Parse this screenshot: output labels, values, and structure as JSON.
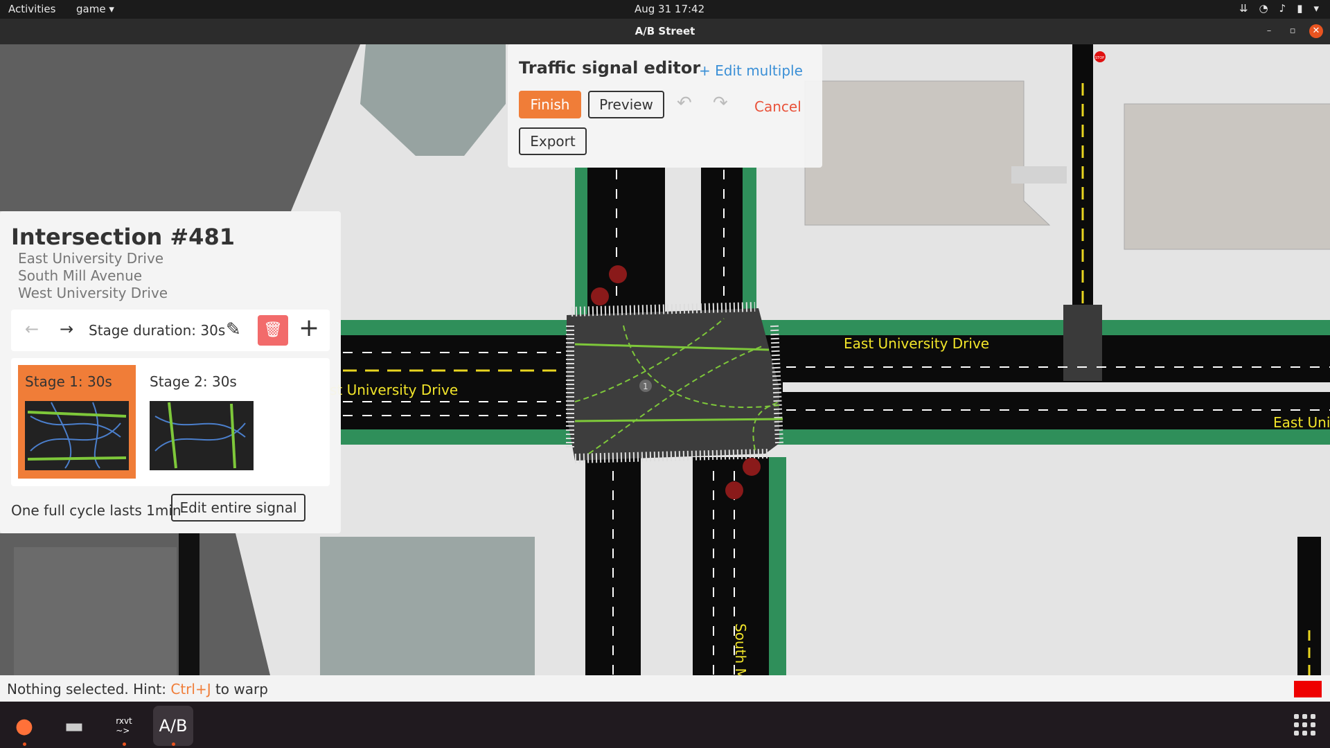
{
  "system": {
    "activities": "Activities",
    "app_menu": "game ▾",
    "clock": "Aug 31  17:42"
  },
  "window": {
    "title": "A/B Street"
  },
  "editor": {
    "title": "Traffic signal editor",
    "edit_multiple": "+ Edit multiple",
    "finish": "Finish",
    "preview": "Preview",
    "cancel": "Cancel",
    "export": "Export"
  },
  "intersection": {
    "title": "Intersection #481",
    "roads": [
      "East University Drive",
      "South Mill Avenue",
      "West University Drive"
    ],
    "stage_duration": "Stage duration: 30s",
    "stages": [
      {
        "label": "Stage 1: 30s",
        "selected": true
      },
      {
        "label": "Stage 2: 30s",
        "selected": false
      }
    ],
    "cycle": "One full cycle lasts 1min",
    "edit_signal": "Edit entire signal"
  },
  "map_labels": {
    "east_univ": "East University Drive",
    "west_univ": "st University Drive",
    "east_uni_short": "East Uni",
    "south_mill_top": "South Mill Ave",
    "south_mill_bottom": "South Mill A",
    "stop": "STOP",
    "intersection_marker": "1"
  },
  "status": {
    "prefix": "Nothing selected. Hint: ",
    "key": "Ctrl+J",
    "suffix": " to warp"
  },
  "dock": {
    "terminal_label": "rxvt\n~>"
  },
  "colors": {
    "accent": "#f07d38",
    "link": "#3a8fd6",
    "cancel": "#e9523a",
    "bike_lane": "#2f8f5a",
    "road": "#0b0b0b",
    "signal_green": "#7ec83a"
  }
}
